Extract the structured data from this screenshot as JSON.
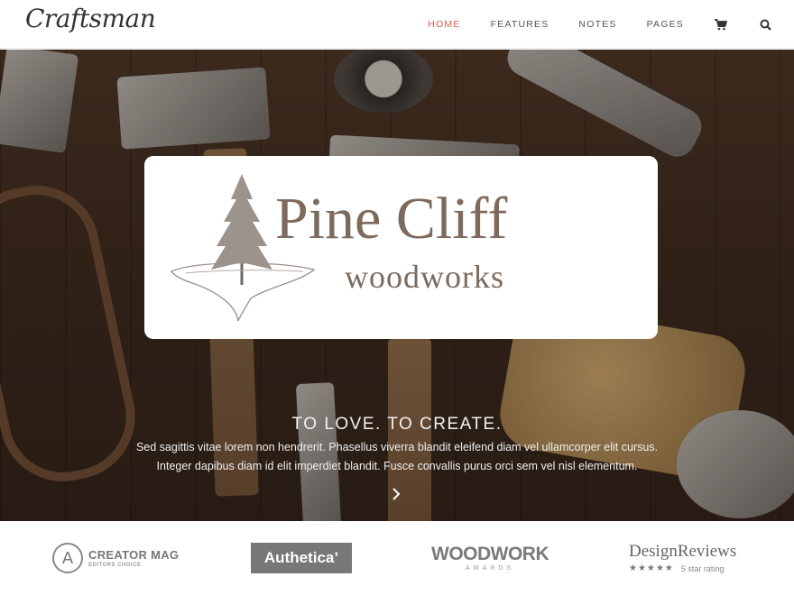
{
  "header": {
    "logo": "Craftsman",
    "nav": [
      {
        "label": "HOME",
        "active": true
      },
      {
        "label": "FEATURES",
        "active": false
      },
      {
        "label": "NOTES",
        "active": false
      },
      {
        "label": "PAGES",
        "active": false
      }
    ],
    "icons": [
      "cart-icon",
      "search-icon"
    ],
    "accent_color": "#e05a4b"
  },
  "hero": {
    "brand": {
      "name": "Pine Cliff",
      "subtitle": "woodworks"
    },
    "tagline": "TO LOVE. TO CREATE.",
    "description_line1": "Sed sagittis vitae lorem non hendrerit. Phasellus viverra blandit eleifend diam vel ullamcorper elit cursus.",
    "description_line2": "Integer dapibus diam id elit imperdiet blandit. Fusce convallis purus orci sem vel nisl elementum.",
    "next_icon": "chevron-right-icon"
  },
  "press": {
    "creator_mag": {
      "title": "CREATOR MAG",
      "subtitle": "EDITORS CHOICE",
      "icon": "A"
    },
    "authetica": {
      "title": "Authetica’"
    },
    "woodwork": {
      "title": "WOODWORK",
      "subtitle": "AWARDS"
    },
    "design_reviews": {
      "title": "DesignReviews",
      "stars": "★★★★★",
      "rating": "5 star rating"
    }
  }
}
